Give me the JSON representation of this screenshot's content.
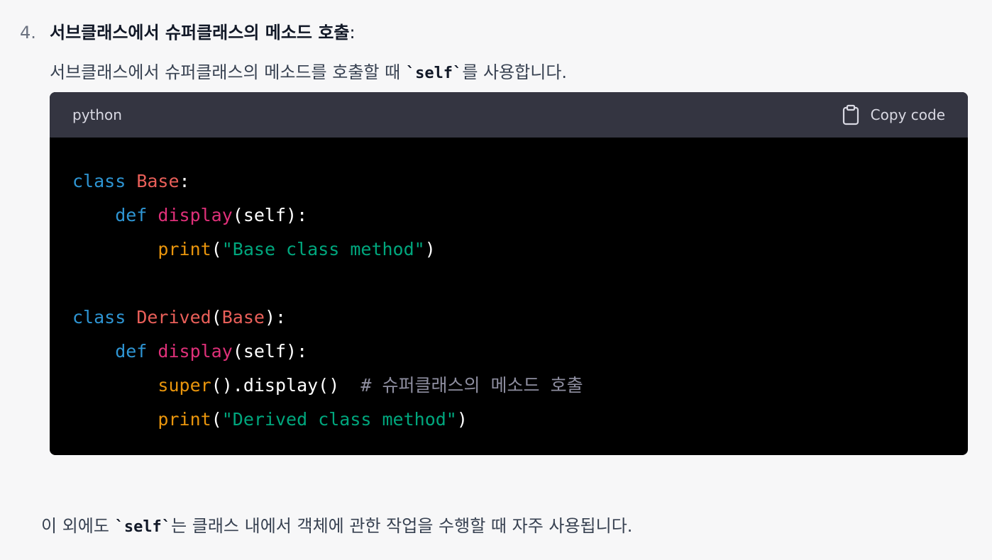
{
  "item": {
    "number": "4.",
    "title": "서브클래스에서 슈퍼클래스의 메소드 호출",
    "colon": ":",
    "description_before": "서브클래스에서 슈퍼클래스의 메소드를 호출할 때 ",
    "description_code": "`self`",
    "description_after": "를 사용합니다."
  },
  "code_block": {
    "language": "python",
    "copy_label": "Copy code",
    "copy_icon": "clipboard-icon",
    "lines": [
      [
        {
          "text": "class ",
          "type": "kw"
        },
        {
          "text": "Base",
          "type": "cls"
        },
        {
          "text": ":",
          "type": "punc"
        }
      ],
      [
        {
          "text": "    def ",
          "type": "kw"
        },
        {
          "text": "display",
          "type": "fn"
        },
        {
          "text": "(self):",
          "type": "plain"
        }
      ],
      [
        {
          "text": "        print",
          "type": "builtin"
        },
        {
          "text": "(",
          "type": "punc"
        },
        {
          "text": "\"Base class method\"",
          "type": "str"
        },
        {
          "text": ")",
          "type": "punc"
        }
      ],
      [],
      [
        {
          "text": "class ",
          "type": "kw"
        },
        {
          "text": "Derived",
          "type": "cls"
        },
        {
          "text": "(",
          "type": "punc"
        },
        {
          "text": "Base",
          "type": "cls"
        },
        {
          "text": "):",
          "type": "punc"
        }
      ],
      [
        {
          "text": "    def ",
          "type": "kw"
        },
        {
          "text": "display",
          "type": "fn"
        },
        {
          "text": "(self):",
          "type": "plain"
        }
      ],
      [
        {
          "text": "        super",
          "type": "builtin"
        },
        {
          "text": "().display()  ",
          "type": "plain"
        },
        {
          "text": "# 슈퍼클래스의 메소드 호출",
          "type": "comment"
        }
      ],
      [
        {
          "text": "        print",
          "type": "builtin"
        },
        {
          "text": "(",
          "type": "punc"
        },
        {
          "text": "\"Derived class method\"",
          "type": "str"
        },
        {
          "text": ")",
          "type": "punc"
        }
      ]
    ],
    "colors": {
      "keyword": "#2e95d3",
      "class_name": "#e95f59",
      "function": "#df3079",
      "builtin": "#e9950c",
      "string": "#00a67d",
      "comment": "#8e8ea0",
      "header_bg": "#343541",
      "code_bg": "#000000"
    }
  },
  "footer": {
    "before": "이 외에도 ",
    "code": "`self`",
    "after": "는 클래스 내에서 객체에 관한 작업을 수행할 때 자주 사용됩니다."
  }
}
